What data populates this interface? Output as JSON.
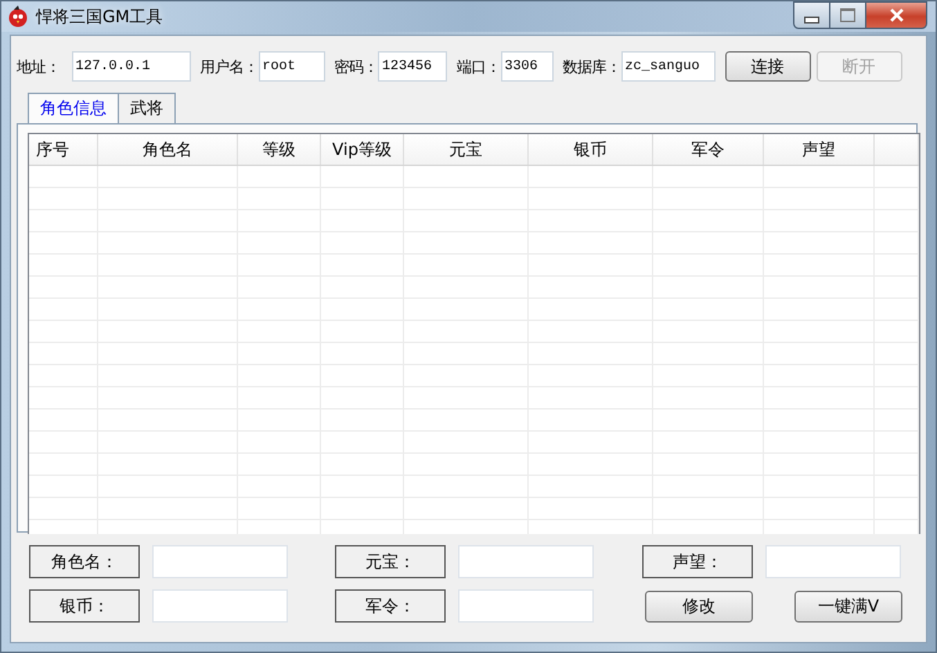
{
  "window": {
    "title": "悍将三国GM工具"
  },
  "connection": {
    "fields": [
      {
        "label": "地址：",
        "value": "127.0.0.1"
      },
      {
        "label": "用户名：",
        "value": "root"
      },
      {
        "label": "密码：",
        "value": "123456"
      },
      {
        "label": "端口：",
        "value": "3306"
      },
      {
        "label": "数据库：",
        "value": "zc_sanguo"
      }
    ],
    "buttons": [
      {
        "label": "连接",
        "disabled": false
      },
      {
        "label": "断开",
        "disabled": true
      }
    ]
  },
  "tabs": [
    {
      "label": "角色信息",
      "selected": true
    },
    {
      "label": "武将",
      "selected": false
    }
  ],
  "table": {
    "columns": [
      "序号",
      "角色名",
      "等级",
      "Vip等级",
      "元宝",
      "银币",
      "军令",
      "声望"
    ]
  },
  "editor": {
    "fields": [
      {
        "label": "角色名："
      },
      {
        "label": "元宝："
      },
      {
        "label": "声望："
      },
      {
        "label": "银币："
      },
      {
        "label": "军令："
      }
    ],
    "buttons": [
      "修改",
      "一键满V"
    ]
  }
}
